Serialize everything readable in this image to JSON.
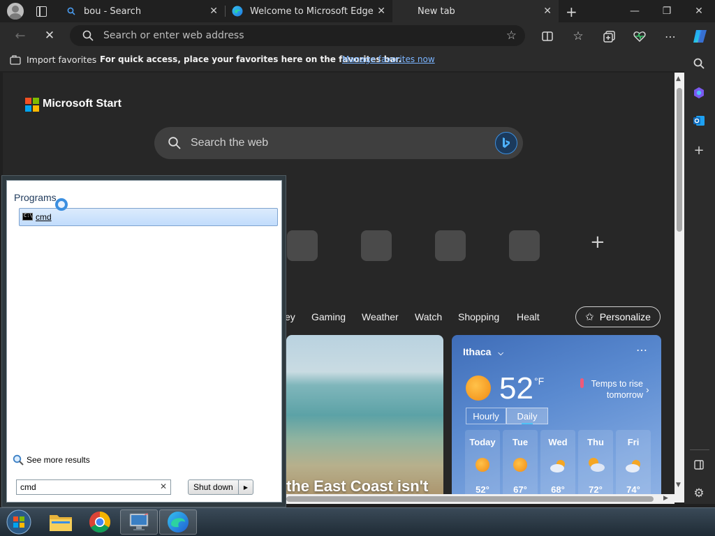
{
  "browser": {
    "tabs": [
      {
        "title": "bou - Search",
        "icon": "search-icon"
      },
      {
        "title": "Welcome to Microsoft Edge",
        "icon": "edge-icon"
      },
      {
        "title": "New tab",
        "icon": "none"
      }
    ],
    "address_placeholder": "Search or enter web address",
    "favorites_bar": {
      "import_label": "Import favorites",
      "message": "For quick access, place your favorites here on the favorites bar.",
      "manage_link": "Manage favorites now"
    }
  },
  "page": {
    "brand": "Microsoft Start",
    "search_placeholder": "Search the web",
    "nav_items": [
      "ey",
      "Gaming",
      "Weather",
      "Watch",
      "Shopping",
      "Healt"
    ],
    "personalize_label": "Personalize",
    "headline": "the East Coast isn't",
    "weather": {
      "location": "Ithaca",
      "temperature": "52",
      "unit": "°F",
      "alert_line1": "Temps to rise",
      "alert_line2": "tomorrow",
      "tab_hourly": "Hourly",
      "tab_daily": "Daily",
      "forecast": [
        {
          "day": "Today",
          "temp": "52°",
          "icon": "sun-icon"
        },
        {
          "day": "Tue",
          "temp": "67°",
          "icon": "sun-icon"
        },
        {
          "day": "Wed",
          "temp": "68°",
          "icon": "cloud-icon"
        },
        {
          "day": "Thu",
          "temp": "72°",
          "icon": "partly-cloudy-icon"
        },
        {
          "day": "Fri",
          "temp": "74°",
          "icon": "cloud-icon"
        }
      ]
    }
  },
  "start_menu": {
    "heading": "Programs",
    "result": "cmd",
    "see_more": "See more results",
    "search_value": "cmd",
    "shutdown_label": "Shut down"
  },
  "colors": {
    "accent": "#7ab4ff",
    "selection": "#c1dcfc"
  }
}
